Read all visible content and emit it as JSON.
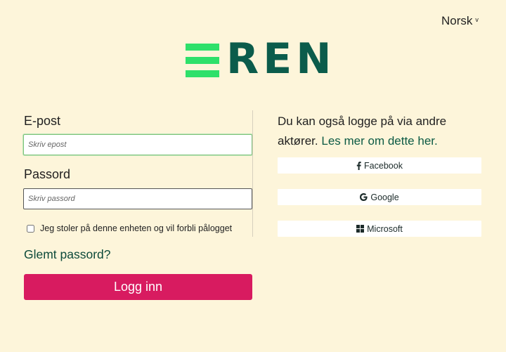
{
  "language": {
    "label": "Norsk",
    "chevron": "v"
  },
  "logo": {
    "text": "REN"
  },
  "form": {
    "email_label": "E-post",
    "email_placeholder": "Skriv epost",
    "password_label": "Passord",
    "password_placeholder": "Skriv passord",
    "remember_label": "Jeg stoler på denne enheten og vil forbli pålogget",
    "forgot_label": "Glemt passord?",
    "login_label": "Logg inn"
  },
  "alternatives": {
    "intro": "Du kan også logge på via andre aktører.",
    "link": "Les mer om dette her.",
    "providers": [
      {
        "label": "Facebook",
        "icon": "facebook-icon"
      },
      {
        "label": "Google",
        "icon": "google-icon"
      },
      {
        "label": "Microsoft",
        "icon": "microsoft-icon"
      }
    ]
  },
  "colors": {
    "background": "#fdf5da",
    "brand_green": "#2ee06a",
    "brand_dark": "#0b5c4b",
    "primary_button": "#d81b60"
  }
}
